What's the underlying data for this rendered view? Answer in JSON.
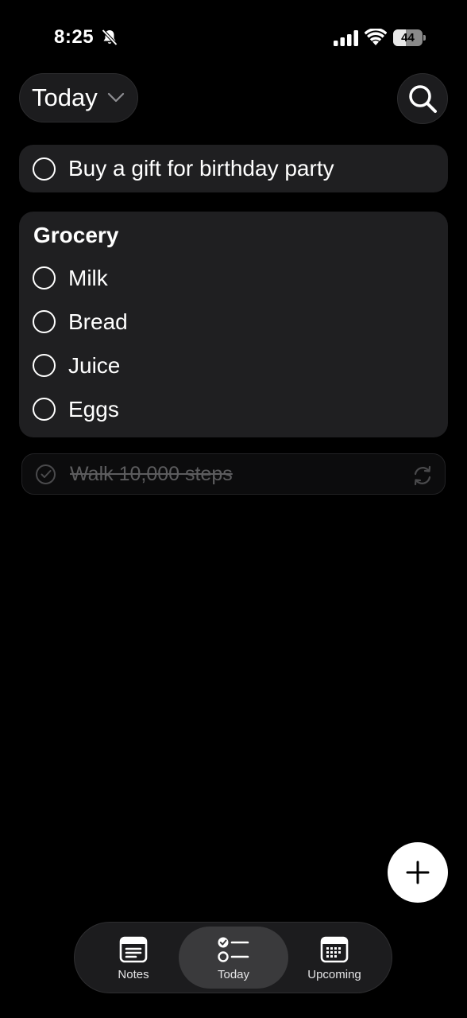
{
  "status_bar": {
    "time": "8:25",
    "battery_level": "44"
  },
  "header": {
    "view_label": "Today"
  },
  "tasks": [
    {
      "text": "Buy a gift for birthday party",
      "completed": false
    }
  ],
  "groups": [
    {
      "title": "Grocery",
      "items": [
        {
          "text": "Milk",
          "completed": false
        },
        {
          "text": "Bread",
          "completed": false
        },
        {
          "text": "Juice",
          "completed": false
        },
        {
          "text": "Eggs",
          "completed": false
        }
      ]
    }
  ],
  "completed_task": {
    "text": "Walk 10,000 steps",
    "completed": true,
    "recurring": true
  },
  "tabbar": {
    "notes": "Notes",
    "today": "Today",
    "upcoming": "Upcoming",
    "active": "today"
  },
  "colors": {
    "background": "#000000",
    "card": "#1f1f21",
    "completed_text": "#5c5c5e",
    "fab": "#ffffff"
  }
}
